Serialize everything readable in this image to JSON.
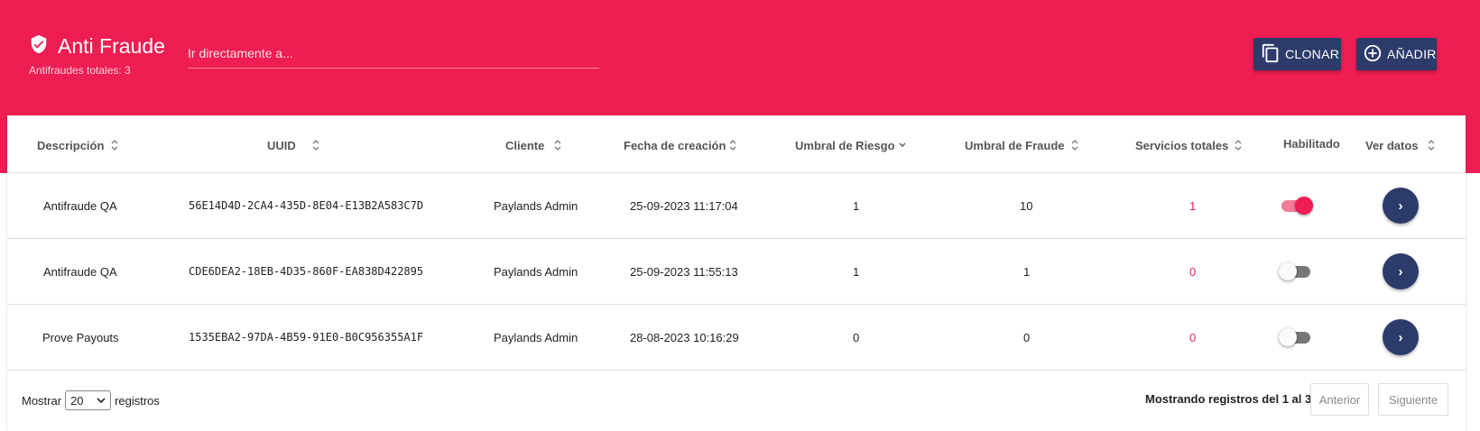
{
  "header": {
    "icon": "shield-check-icon",
    "title": "Anti Fraude",
    "subtitle": "Antifraudes totales: 3",
    "search_placeholder": "Ir directamente a...",
    "clone_label": "CLONAR",
    "add_label": "AÑADIR",
    "brand_color": "#ee1d52",
    "accent_color": "#2d3b6b"
  },
  "table": {
    "columns": [
      "Descripción",
      "UUID",
      "Cliente",
      "Fecha de creación",
      "Umbral de Riesgo",
      "Umbral de Fraude",
      "Servicios totales",
      "Habilitado",
      "Ver datos"
    ],
    "rows": [
      {
        "descripcion": "Antifraude QA",
        "uuid": "56E14D4D-2CA4-435D-8E04-E13B2A583C7D",
        "cliente": "Paylands Admin",
        "fecha": "25-09-2023 11:17:04",
        "riesgo": "1",
        "fraude": "10",
        "servicios": "1",
        "habilitado": true,
        "ver_icon": "chevron-right-icon"
      },
      {
        "descripcion": "Antifraude QA",
        "uuid": "CDE6DEA2-18EB-4D35-860F-EA838D422895",
        "cliente": "Paylands Admin",
        "fecha": "25-09-2023 11:55:13",
        "riesgo": "1",
        "fraude": "1",
        "servicios": "0",
        "habilitado": false,
        "ver_icon": "chevron-right-icon"
      },
      {
        "descripcion": "Prove Payouts",
        "uuid": "1535EBA2-97DA-4B59-91E0-B0C956355A1F",
        "cliente": "Paylands Admin",
        "fecha": "28-08-2023 10:16:29",
        "riesgo": "0",
        "fraude": "0",
        "servicios": "0",
        "habilitado": false,
        "ver_icon": "chevron-right-icon"
      }
    ]
  },
  "footer": {
    "show_label": "Mostrar",
    "page_size": "20",
    "records_label": "registros",
    "showing_text": "Mostrando registros del 1 al 3",
    "prev_label": "Anterior",
    "next_label": "Siguiente"
  }
}
